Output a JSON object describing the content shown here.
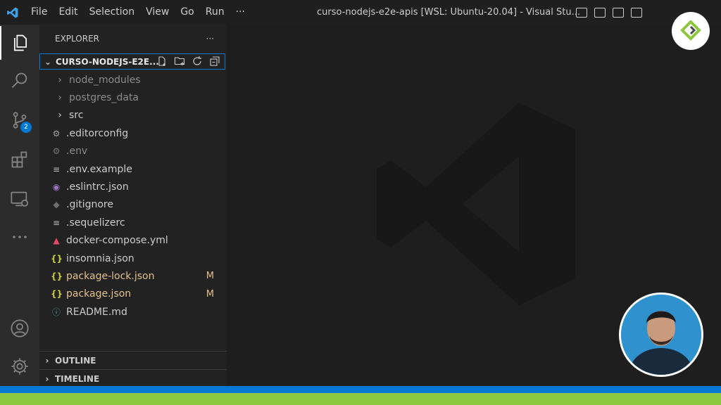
{
  "titlebar": {
    "menu": [
      "File",
      "Edit",
      "Selection",
      "View",
      "Go",
      "Run",
      "···"
    ],
    "title": "curso-nodejs-e2e-apis [WSL: Ubuntu-20.04] - Visual Stu..."
  },
  "activity": {
    "scm_badge": "2",
    "icons": [
      "explorer-icon",
      "search-icon",
      "source-control-icon",
      "extensions-icon",
      "remote-explorer-icon",
      "more-icon",
      "account-icon",
      "gear-icon"
    ]
  },
  "sidebar": {
    "header": "EXPLORER",
    "header_more": "···",
    "folder": "CURSO-NODEJS-E2E...",
    "items": [
      {
        "label": "node_modules",
        "kind": "folder",
        "status": ""
      },
      {
        "label": "postgres_data",
        "kind": "folder",
        "status": ""
      },
      {
        "label": "src",
        "kind": "folder",
        "status": ""
      },
      {
        "label": ".editorconfig",
        "kind": "gear",
        "status": ""
      },
      {
        "label": ".env",
        "kind": "gear",
        "status": ""
      },
      {
        "label": ".env.example",
        "kind": "lines",
        "status": ""
      },
      {
        "label": ".eslintrc.json",
        "kind": "eslint",
        "status": ""
      },
      {
        "label": ".gitignore",
        "kind": "git",
        "status": ""
      },
      {
        "label": ".sequelizerc",
        "kind": "lines",
        "status": ""
      },
      {
        "label": "docker-compose.yml",
        "kind": "docker",
        "status": ""
      },
      {
        "label": "insomnia.json",
        "kind": "json",
        "status": ""
      },
      {
        "label": "package-lock.json",
        "kind": "json",
        "status": "M"
      },
      {
        "label": "package.json",
        "kind": "json",
        "status": "M"
      },
      {
        "label": "README.md",
        "kind": "info",
        "status": ""
      }
    ],
    "outline": "OUTLINE",
    "timeline": "TIMELINE"
  },
  "colors": {
    "accent": "#0078d4",
    "modified": "#e2c08d",
    "brand_green": "#8dc63f"
  }
}
